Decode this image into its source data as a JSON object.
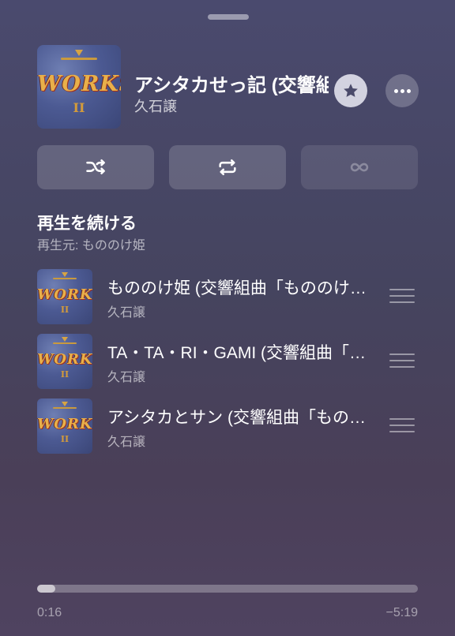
{
  "now_playing": {
    "title": "アシタカせっ記 (交響組曲「もののけ姫」)",
    "artist": "久石譲",
    "artwork_text": "WORKS",
    "artwork_sub": "II"
  },
  "controls": {
    "shuffle_icon": "shuffle-icon",
    "repeat_icon": "repeat-icon",
    "autoplay_icon": "infinity-icon",
    "star_icon": "star-icon",
    "more_icon": "ellipsis-icon"
  },
  "queue": {
    "heading": "再生を続ける",
    "source": "再生元: もののけ姫",
    "items": [
      {
        "title": "もののけ姫 (交響組曲「もののけ姫」)",
        "artist": "久石譲"
      },
      {
        "title": "TA・TA・RI・GAMI (交響組曲「もののけ姫」)",
        "artist": "久石譲"
      },
      {
        "title": "アシタカとサン (交響組曲「もののけ姫」)",
        "artist": "久石譲"
      }
    ]
  },
  "progress": {
    "elapsed": "0:16",
    "remaining": "−5:19",
    "fraction": 0.048
  },
  "colors": {
    "background_top": "#4a4a6e",
    "background_bottom": "#4f4360",
    "artwork_gold": "#e8b04a"
  }
}
